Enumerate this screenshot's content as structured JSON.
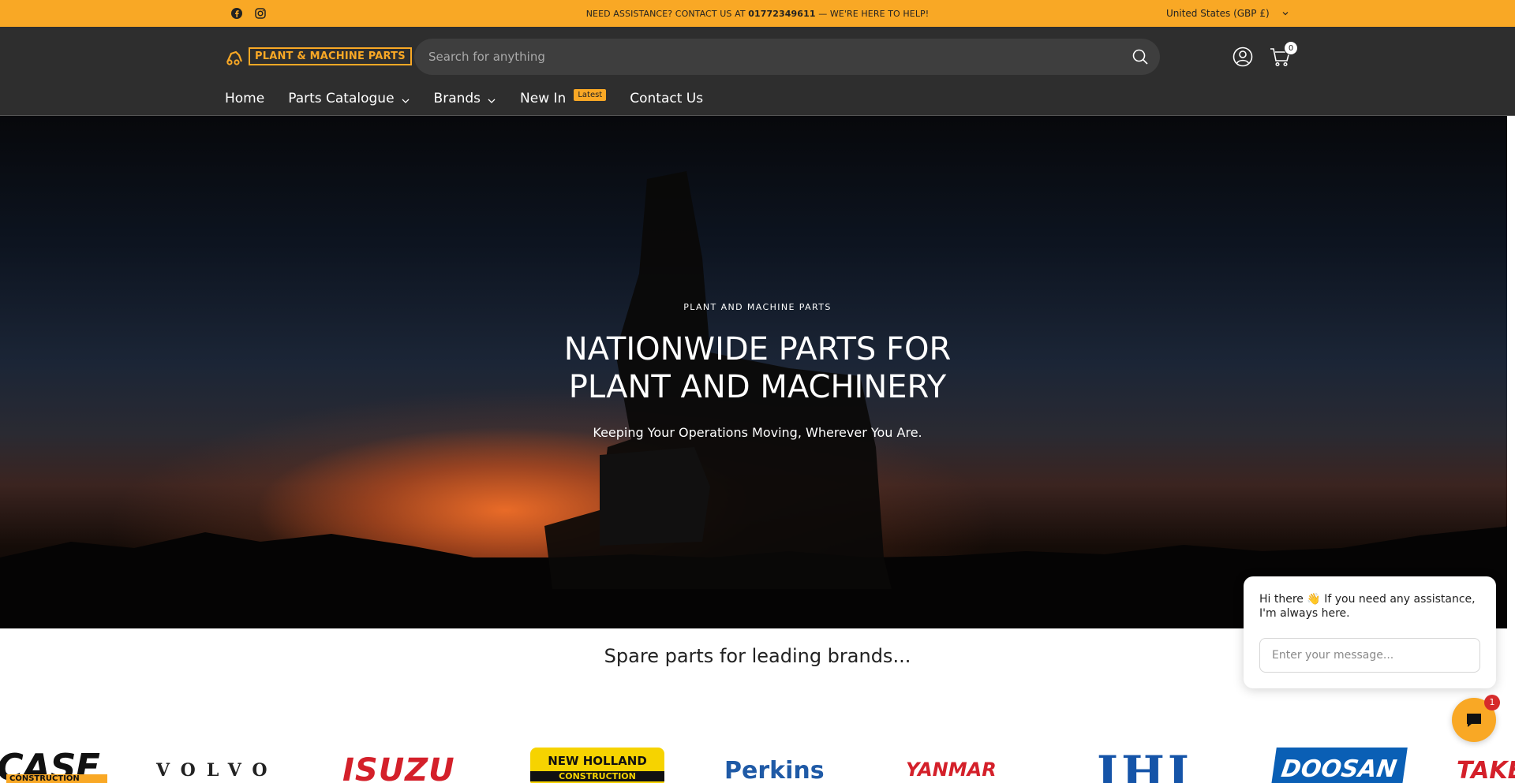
{
  "topbar": {
    "announcement_prefix": "NEED ASSISTANCE? CONTACT US AT",
    "phone": "01772349611",
    "announcement_suffix": "— WE'RE HERE TO HELP!",
    "currency": "United States (GBP £)",
    "social_icons": [
      "facebook-icon",
      "instagram-icon"
    ]
  },
  "header": {
    "logo_text": "PLANT & MACHINE PARTS",
    "search_placeholder": "Search for anything",
    "cart_count": "0",
    "icons": [
      "search-icon",
      "account-icon",
      "cart-icon"
    ]
  },
  "nav": {
    "items": [
      {
        "label": "Home",
        "dropdown": false
      },
      {
        "label": "Parts Catalogue",
        "dropdown": true
      },
      {
        "label": "Brands",
        "dropdown": true
      },
      {
        "label": "New In",
        "dropdown": false,
        "badge": "Latest"
      },
      {
        "label": "Contact Us",
        "dropdown": false
      }
    ]
  },
  "hero": {
    "eyebrow": "PLANT AND MACHINE PARTS",
    "title": "NATIONWIDE PARTS FOR PLANT AND MACHINERY",
    "subtitle": "Keeping Your Operations Moving, Wherever You Are."
  },
  "brands": {
    "heading": "Spare parts for leading brands...",
    "logos": [
      "CASE",
      "CONSTRUCTION",
      "VOLVO",
      "ISUZU",
      "NEW HOLLAND",
      "CONSTRUCTION",
      "Perkins",
      "YANMAR",
      "IHI",
      "DOOSAN",
      "TAKE"
    ]
  },
  "chat": {
    "greeting": "Hi there 👋 If you need any assistance, I'm always here.",
    "input_placeholder": "Enter your message...",
    "unread_count": "1"
  },
  "colors": {
    "accent": "#f9a825",
    "header_bg": "#2e2e2e",
    "unread_badge": "#d62b2b"
  }
}
